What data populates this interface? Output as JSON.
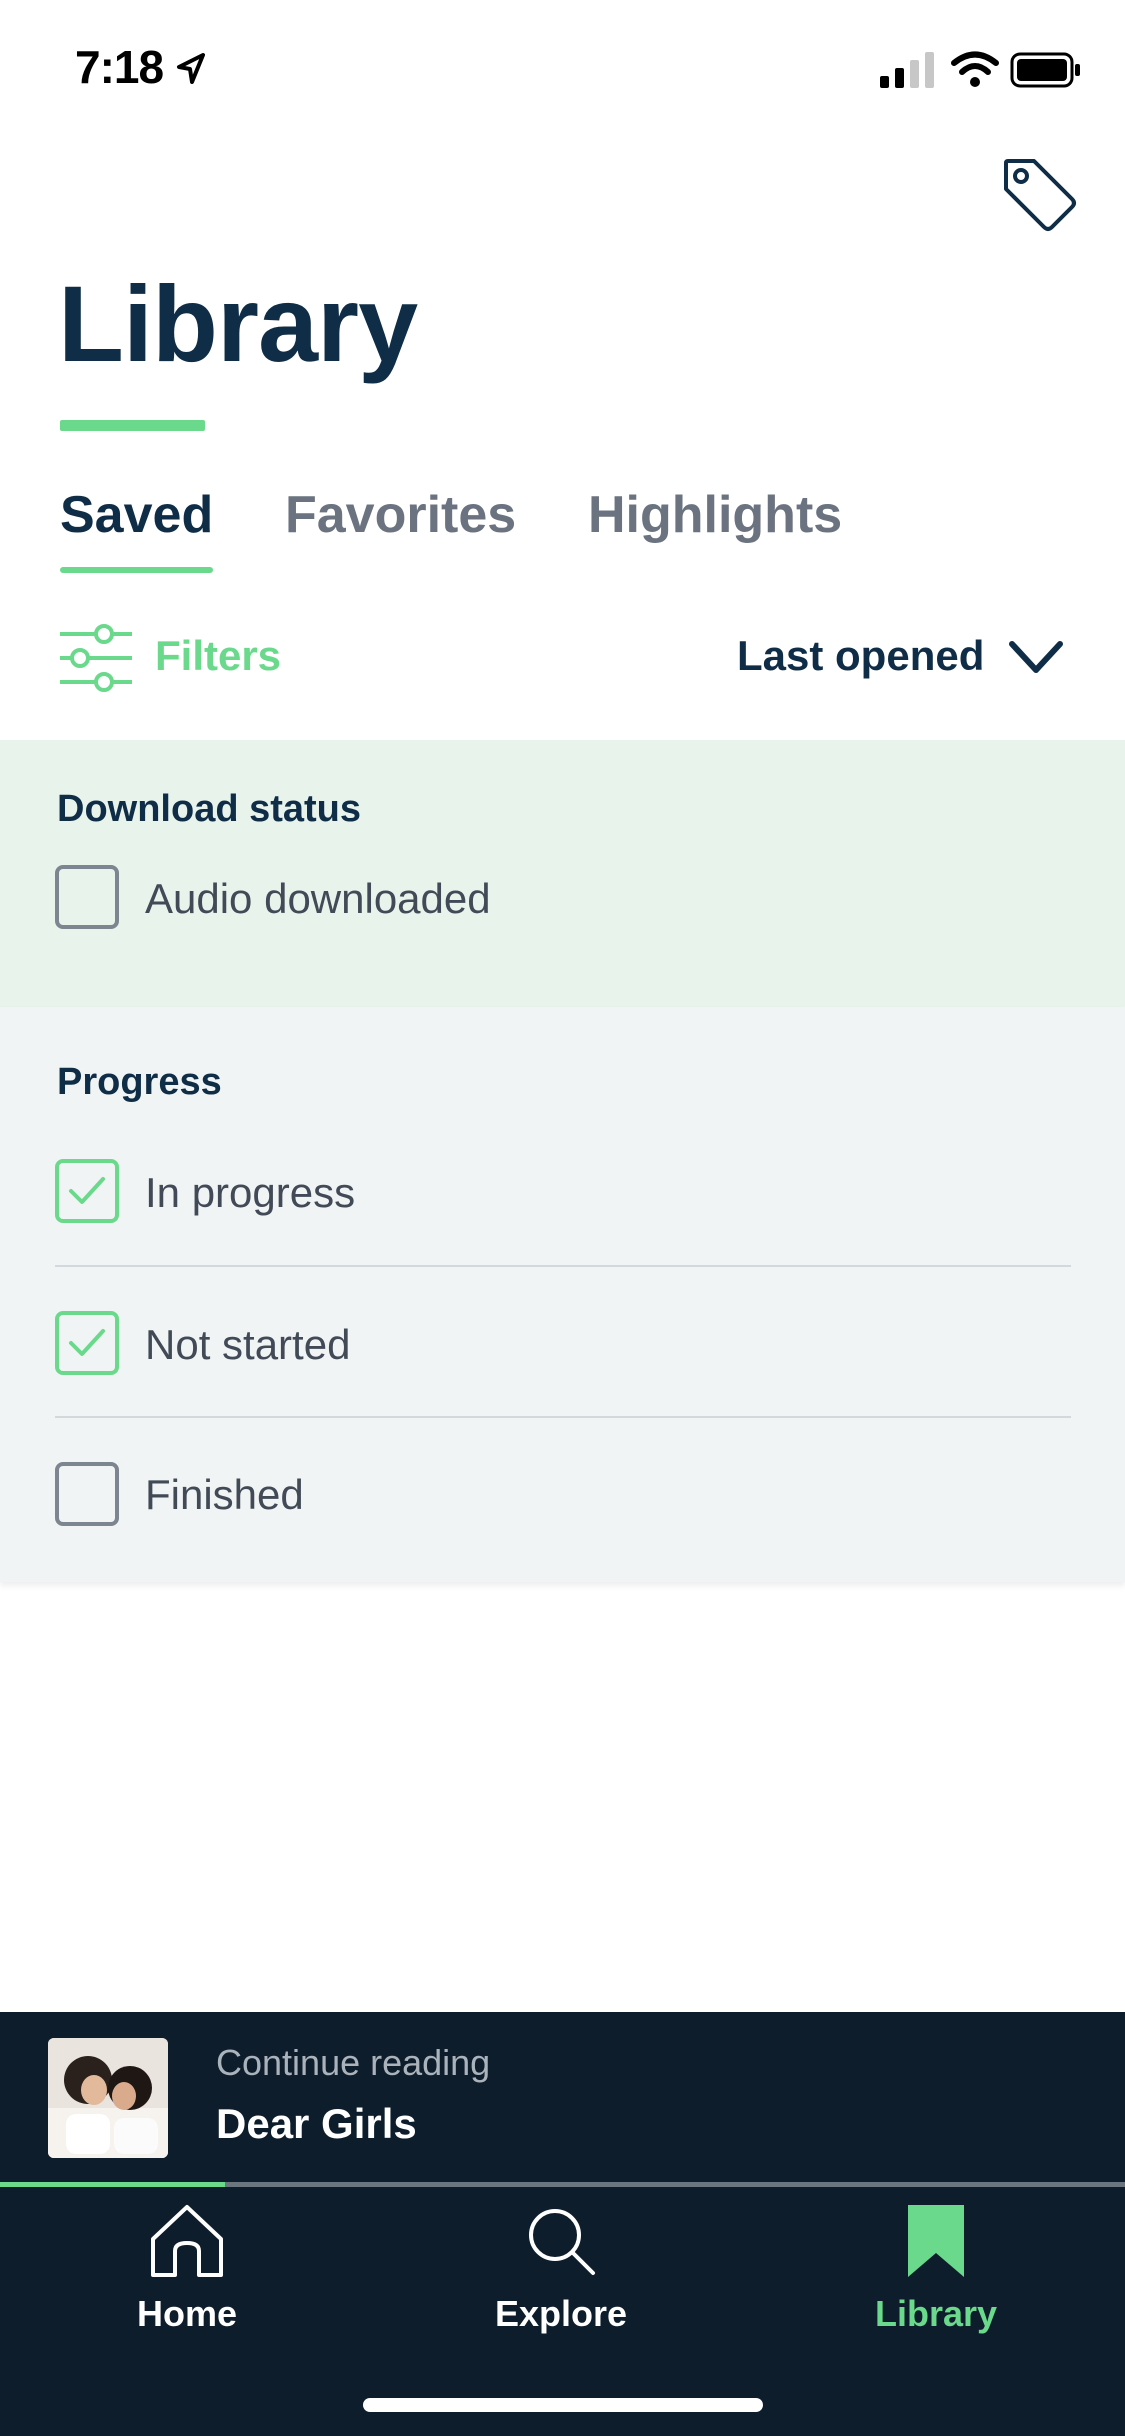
{
  "status_bar": {
    "time": "7:18"
  },
  "header": {
    "title": "Library"
  },
  "tabs": [
    {
      "label": "Saved",
      "active": true
    },
    {
      "label": "Favorites",
      "active": false
    },
    {
      "label": "Highlights",
      "active": false
    }
  ],
  "filter_bar": {
    "filters_label": "Filters",
    "sort_label": "Last opened"
  },
  "filters": {
    "download": {
      "title": "Download status",
      "options": [
        {
          "label": "Audio downloaded",
          "checked": false
        }
      ]
    },
    "progress": {
      "title": "Progress",
      "options": [
        {
          "label": "In progress",
          "checked": true
        },
        {
          "label": "Not started",
          "checked": true
        },
        {
          "label": "Finished",
          "checked": false
        }
      ]
    }
  },
  "continue_reading": {
    "label": "Continue reading",
    "book_title": "Dear Girls",
    "progress": 0.2
  },
  "bottom_nav": [
    {
      "label": "Home",
      "icon": "home-icon",
      "active": false
    },
    {
      "label": "Explore",
      "icon": "search-icon",
      "active": false
    },
    {
      "label": "Library",
      "icon": "bookmark-icon",
      "active": true
    }
  ],
  "colors": {
    "accent": "#6bd98b",
    "navy": "#0f2d46",
    "nav_bg": "#0e1d2b"
  }
}
